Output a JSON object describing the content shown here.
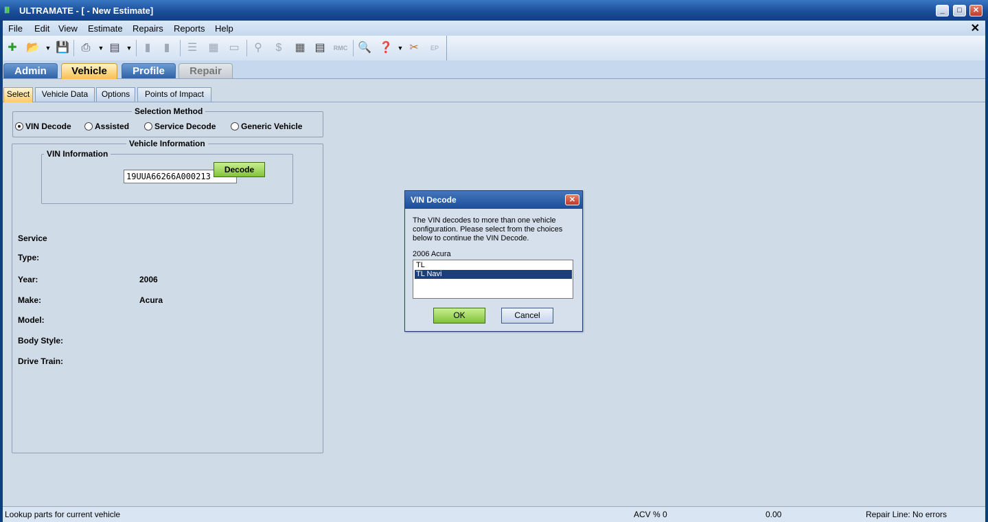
{
  "window": {
    "title": "ULTRAMATE - [ - New Estimate]",
    "controls": [
      "_",
      "□",
      "✕"
    ]
  },
  "menu": {
    "items": [
      "File",
      "Edit",
      "View",
      "Estimate",
      "Repairs",
      "Reports",
      "Help"
    ],
    "close_glyph": "✕"
  },
  "main_tabs": [
    "Admin",
    "Vehicle",
    "Profile",
    "Repair"
  ],
  "sub_tabs": [
    "Select",
    "Vehicle Data",
    "Options",
    "Points of Impact"
  ],
  "selection_method": {
    "title": "Selection Method",
    "options": [
      "VIN Decode",
      "Assisted",
      "Service Decode",
      "Generic Vehicle"
    ],
    "selected": "VIN Decode"
  },
  "vehicle_info": {
    "title": "Vehicle Information",
    "vin_group_title": "VIN Information",
    "vin_value": "19UUA66266A000213",
    "decode_label": "Decode",
    "fields": [
      {
        "label": "Service",
        "value": ""
      },
      {
        "label": "Type:",
        "value": ""
      },
      {
        "label": "Year:",
        "value": "2006"
      },
      {
        "label": "Make:",
        "value": "Acura"
      },
      {
        "label": "Model:",
        "value": ""
      },
      {
        "label": "Body Style:",
        "value": ""
      },
      {
        "label": "Drive Train:",
        "value": ""
      }
    ]
  },
  "dialog": {
    "title": "VIN Decode",
    "message": "The VIN decodes to more than one vehicle configuration. Please select from the choices below to continue the VIN Decode.",
    "subtitle": "2006 Acura",
    "options": [
      "TL",
      "TL Navi"
    ],
    "selected": "TL Navi",
    "ok_label": "OK",
    "cancel_label": "Cancel"
  },
  "status": {
    "message": "Lookup parts for current vehicle",
    "acv": "ACV % 0",
    "amount": "0.00",
    "repair_line": "Repair Line: No errors"
  },
  "colors": {
    "title_bar": "#1a4f9a",
    "active_tab": "#f5c150",
    "selected_row": "#1e3e78",
    "green_button": "#83c23b"
  }
}
